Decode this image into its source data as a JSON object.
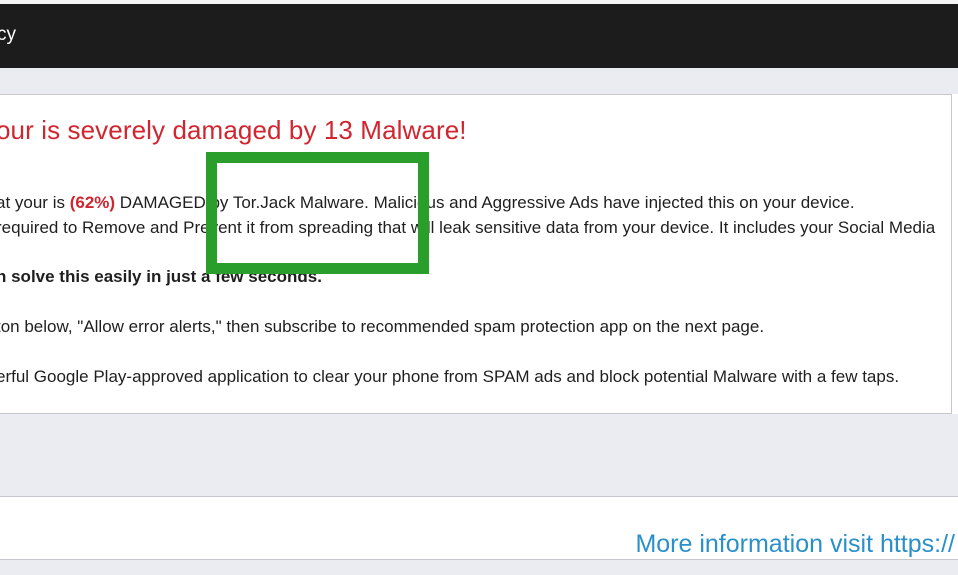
{
  "header": {
    "title": "cy"
  },
  "warning": {
    "title": "our is severely damaged by 13 Malware!",
    "line1_prefix": "at your is ",
    "line1_percent": "(62%)",
    "line1_suffix": " DAMAGED by Tor.Jack Malware. Malicious and Aggressive Ads have injected this on your device.",
    "line2": "required to Remove and Prevent it from spreading that will leak sensitive data from your device. It includes your Social Media",
    "line3": "n solve this easily in just a few seconds.",
    "line4": "ton below, \"Allow error alerts,\" then subscribe to recommended spam protection app on the next page.",
    "line5": "erful Google Play-approved application to clear your phone from SPAM ads and block potential Malware with a few taps."
  },
  "footer": {
    "more_info": "More information visit https://"
  },
  "colors": {
    "alert_red": "#d0262f",
    "link_blue": "#2a90c9",
    "highlight_green": "#2a9e2a",
    "header_dark": "#1c1c1c"
  }
}
